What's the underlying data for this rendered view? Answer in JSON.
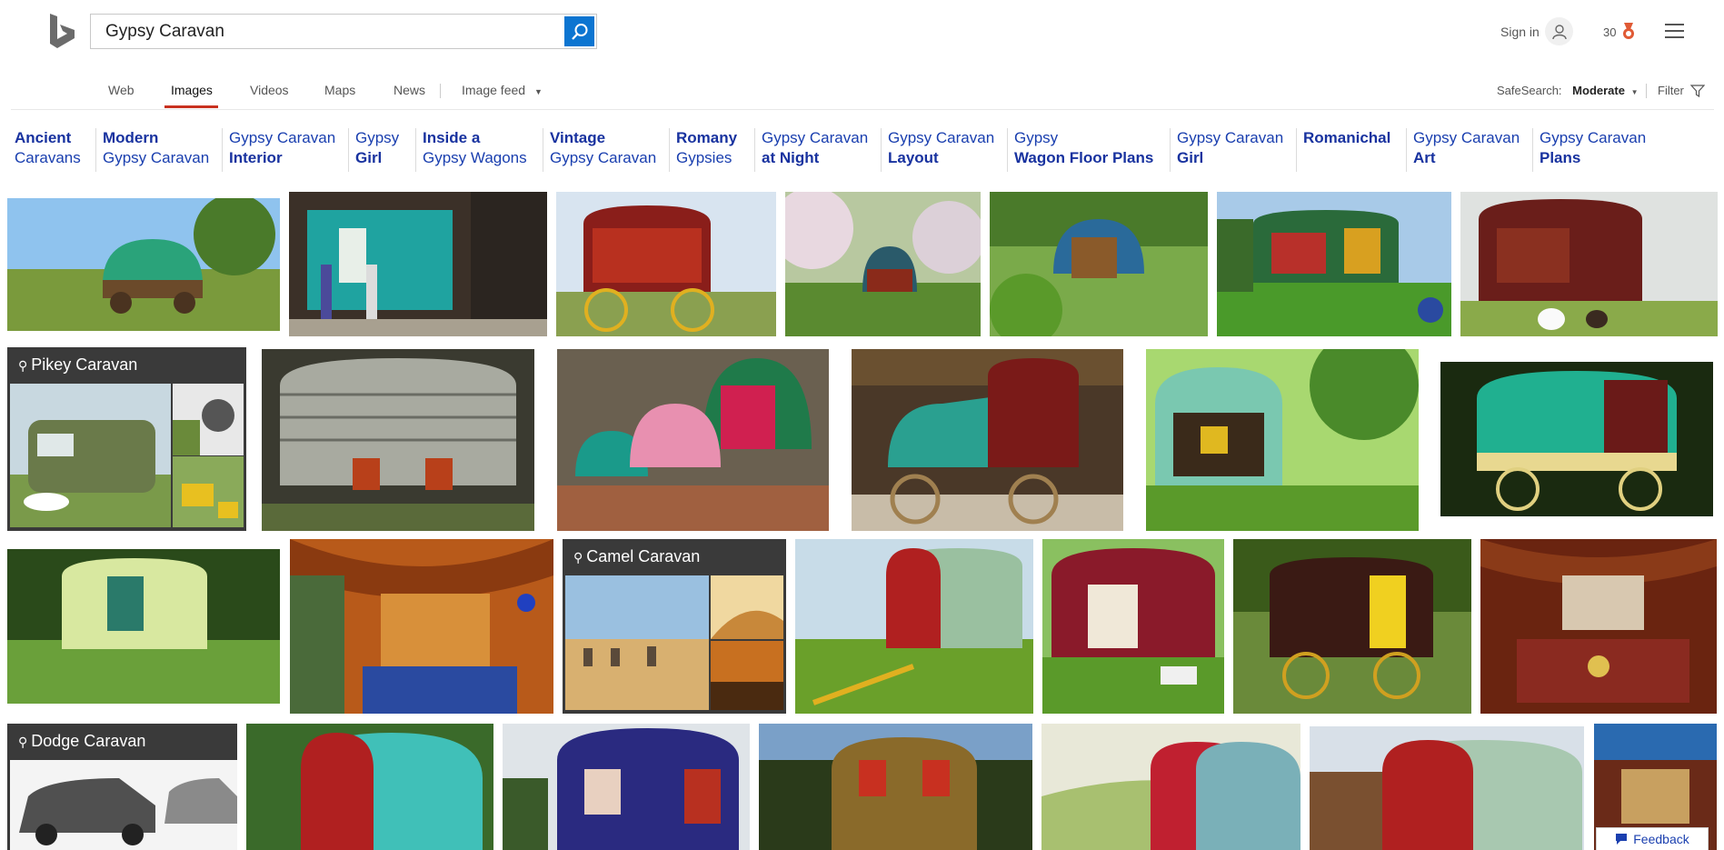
{
  "search": {
    "query": "Gypsy Caravan"
  },
  "header": {
    "signin": "Sign in",
    "rewards_count": "30"
  },
  "nav": {
    "web": "Web",
    "images": "Images",
    "videos": "Videos",
    "maps": "Maps",
    "news": "News",
    "image_feed": "Image feed",
    "safesearch_label": "SafeSearch:",
    "safesearch_value": "Moderate",
    "filter": "Filter"
  },
  "related": [
    {
      "l1": "Ancient",
      "l2": "Caravans"
    },
    {
      "l1": "Modern",
      "l2": "Gypsy Caravan"
    },
    {
      "l1": "Gypsy Caravan",
      "l2": "Interior"
    },
    {
      "l1": "Gypsy",
      "l2": "Girl"
    },
    {
      "l1": "Inside a",
      "l2": "Gypsy Wagons"
    },
    {
      "l1": "Vintage",
      "l2": "Gypsy Caravan"
    },
    {
      "l1": "Romany",
      "l2": "Gypsies"
    },
    {
      "l1": "Gypsy Caravan",
      "l2": "at Night"
    },
    {
      "l1": "Gypsy Caravan",
      "l2": "Layout"
    },
    {
      "l1": "Gypsy",
      "l2": "Wagon Floor Plans"
    },
    {
      "l1": "Gypsy Caravan",
      "l2": "Girl"
    },
    {
      "l1": "Romanichal",
      "l2": ""
    },
    {
      "l1": "Gypsy Caravan",
      "l2": "Art"
    },
    {
      "l1": "Gypsy Caravan",
      "l2": "Plans"
    }
  ],
  "related_searches": {
    "pikey": "Pikey Caravan",
    "camel": "Camel Caravan",
    "dodge": "Dodge Caravan"
  },
  "feedback": "Feedback",
  "colors": {
    "accent": "#0c75d1",
    "link": "#1a3faf",
    "active_tab": "#c8311f"
  }
}
